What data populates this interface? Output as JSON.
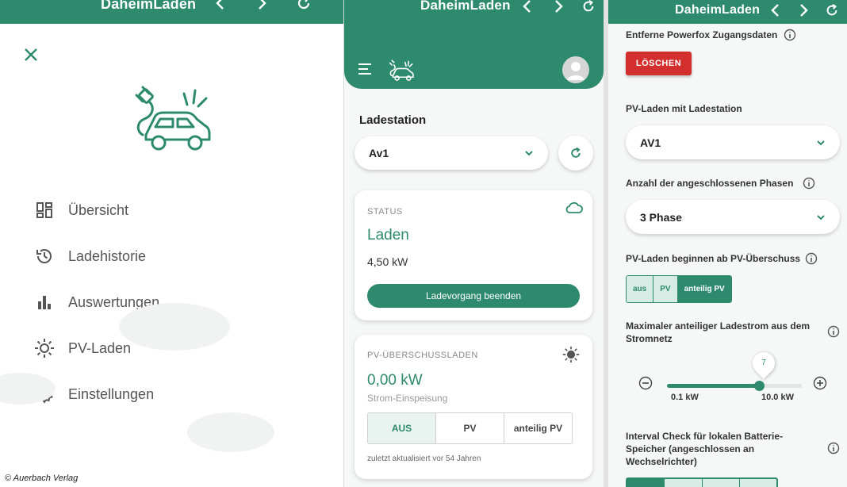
{
  "colors": {
    "brand": "#2e8a6d",
    "danger": "#d32f2f"
  },
  "app_title": "DaheimLaden",
  "credit": "© Auerbach Verlag",
  "menu": {
    "items": [
      {
        "label": "Übersicht",
        "icon": "dashboard-icon"
      },
      {
        "label": "Ladehistorie",
        "icon": "history-icon"
      },
      {
        "label": "Auswertungen",
        "icon": "bar-chart-icon"
      },
      {
        "label": "PV-Laden",
        "icon": "sun-icon"
      },
      {
        "label": "Einstellungen",
        "icon": "gear-icon"
      }
    ]
  },
  "dashboard": {
    "section_title": "Ladestation",
    "station_select": "Av1",
    "status_card": {
      "label": "STATUS",
      "state": "Laden",
      "power": "4,50 kW",
      "button": "Ladevorgang beenden"
    },
    "pv_card": {
      "label": "PV-ÜBERSCHUSSLADEN",
      "power": "0,00 kW",
      "sub": "Strom-Einspeisung",
      "options": [
        "AUS",
        "PV",
        "anteilig PV"
      ],
      "active_option": "AUS",
      "updated": "zuletzt aktualisiert vor 54 Jahren"
    }
  },
  "settings": {
    "powerfox_label": "Entferne Powerfox Zugangsdaten",
    "delete_button": "LÖSCHEN",
    "pv_station_label": "PV-Laden mit Ladestation",
    "pv_station_value": "AV1",
    "phases_label": "Anzahl der angeschlossenen Phasen",
    "phases_value": "3 Phase",
    "pv_start_label": "PV-Laden beginnen ab PV-Überschuss",
    "pv_start_options": [
      "aus",
      "PV",
      "anteilig PV"
    ],
    "pv_start_active": "anteilig PV",
    "max_current_label_1": "Maximaler anteiliger Ladestrom aus dem",
    "max_current_label_2": "Stromnetz",
    "slider": {
      "value": "7",
      "min_label": "0.1 kW",
      "max_label": "10.0 kW",
      "fraction": 0.68
    },
    "interval_label_1": "Interval Check für lokalen Batterie-",
    "interval_label_2": "Speicher (angeschlossen an",
    "interval_label_3": "Wechselrichter)"
  }
}
